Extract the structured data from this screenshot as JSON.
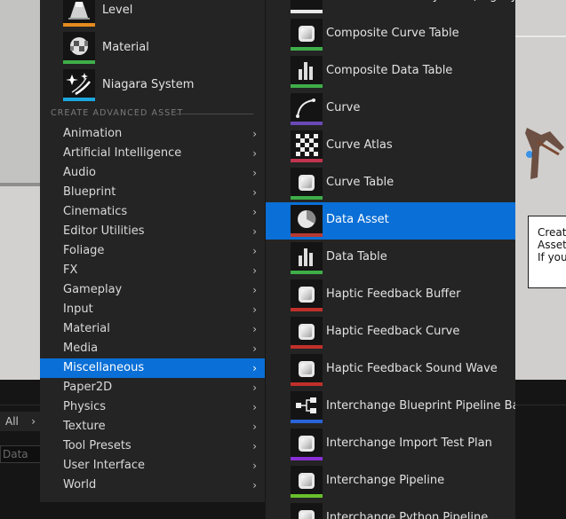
{
  "menu_left": {
    "top_assets": [
      {
        "label": "Level",
        "icon": "level-icon",
        "stripe": "#e58a1f"
      },
      {
        "label": "Material",
        "icon": "material-icon",
        "stripe": "#3fae49"
      },
      {
        "label": "Niagara System",
        "icon": "niagara-icon",
        "stripe": "#1ca6de"
      }
    ],
    "section_header": "CREATE ADVANCED ASSET",
    "categories": [
      "Animation",
      "Artificial Intelligence",
      "Audio",
      "Blueprint",
      "Cinematics",
      "Editor Utilities",
      "Foliage",
      "FX",
      "Gameplay",
      "Input",
      "Material",
      "Media",
      "Miscellaneous",
      "Paper2D",
      "Physics",
      "Texture",
      "Tool Presets",
      "User Interface",
      "World"
    ],
    "selected_category": "Miscellaneous",
    "arrow_glyph": "›"
  },
  "menu_right": {
    "items": [
      {
        "label": "Cascade Particle System (Legacy)",
        "icon": "particle-icon",
        "stripe": "#e8e8e8"
      },
      {
        "label": "Composite Curve Table",
        "icon": "cube-icon",
        "stripe": "#3fae49"
      },
      {
        "label": "Composite Data Table",
        "icon": "bars-icon",
        "stripe": "#3fae49"
      },
      {
        "label": "Curve",
        "icon": "curve-icon",
        "stripe": "#6a49b8"
      },
      {
        "label": "Curve Atlas",
        "icon": "checker-icon",
        "stripe": "#c0344f"
      },
      {
        "label": "Curve Table",
        "icon": "cube-icon",
        "stripe": "#3fae49"
      },
      {
        "label": "Data Asset",
        "icon": "pie-icon",
        "stripe": "#b73a33"
      },
      {
        "label": "Data Table",
        "icon": "bars-icon",
        "stripe": "#3fae49"
      },
      {
        "label": "Haptic Feedback Buffer",
        "icon": "cube-icon",
        "stripe": "#c0302b"
      },
      {
        "label": "Haptic Feedback Curve",
        "icon": "cube-icon",
        "stripe": "#c0302b"
      },
      {
        "label": "Haptic Feedback Sound Wave",
        "icon": "cube-icon",
        "stripe": "#c0302b"
      },
      {
        "label": "Interchange Blueprint Pipeline Base",
        "icon": "pipeline-icon",
        "stripe": "#2a63d8"
      },
      {
        "label": "Interchange Import Test Plan",
        "icon": "cube-icon",
        "stripe": "#8a2fd6"
      },
      {
        "label": "Interchange Pipeline",
        "icon": "cube-icon",
        "stripe": "#6ac02b"
      },
      {
        "label": "Interchange Python Pipeline",
        "icon": "cube-icon",
        "stripe": "#6ac02b"
      }
    ],
    "selected_item": "Data Asset"
  },
  "tooltip": {
    "lines": [
      "Create",
      "Assets",
      "If you"
    ]
  },
  "content_browser": {
    "filter_label": "All",
    "filter_arrow": "›",
    "search_placeholder": "Data"
  },
  "colors": {
    "menu_bg": "#242424",
    "selection": "#0a6fd6"
  }
}
